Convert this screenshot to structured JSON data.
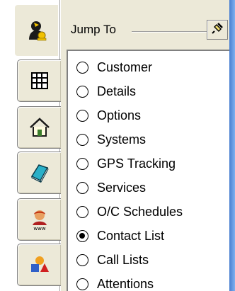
{
  "jump_to": {
    "title": "Jump To",
    "options": [
      {
        "label": "Customer",
        "checked": false
      },
      {
        "label": "Details",
        "checked": false
      },
      {
        "label": "Options",
        "checked": false
      },
      {
        "label": "Systems",
        "checked": false
      },
      {
        "label": "GPS Tracking",
        "checked": false
      },
      {
        "label": "Services",
        "checked": false
      },
      {
        "label": "O/C Schedules",
        "checked": false
      },
      {
        "label": "Contact List",
        "checked": true
      },
      {
        "label": "Call Lists",
        "checked": false
      },
      {
        "label": "Attentions",
        "checked": false
      }
    ]
  },
  "tabs": [
    {
      "icon": "user-key-icon",
      "active": true
    },
    {
      "icon": "grid-icon",
      "active": false
    },
    {
      "icon": "home-icon",
      "active": false
    },
    {
      "icon": "book-icon",
      "active": false
    },
    {
      "icon": "web-user-icon",
      "active": false
    },
    {
      "icon": "shapes-icon",
      "active": false
    }
  ],
  "colors": {
    "panel_bg": "#ece9d8",
    "scroll_accent": "#4a7fd0"
  }
}
